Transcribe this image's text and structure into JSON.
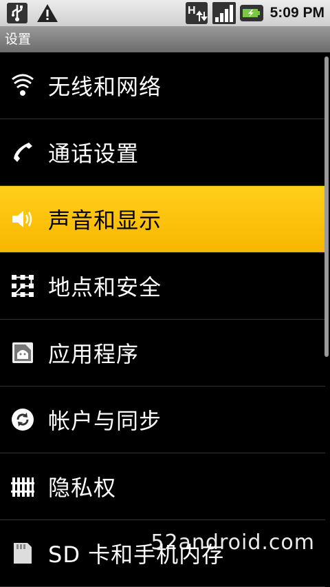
{
  "status_bar": {
    "time": "5:09 PM",
    "network_type": "H",
    "icons": [
      "usb-icon",
      "warning-icon",
      "network-h-icon",
      "signal-icon",
      "battery-charging-icon"
    ]
  },
  "title_bar": {
    "title": "设置"
  },
  "menu": {
    "items": [
      {
        "label": "无线和网络",
        "icon": "wifi-icon"
      },
      {
        "label": "通话设置",
        "icon": "phone-icon"
      },
      {
        "label": "声音和显示",
        "icon": "speaker-icon",
        "selected": true
      },
      {
        "label": "地点和安全",
        "icon": "pattern-lock-icon"
      },
      {
        "label": "应用程序",
        "icon": "applications-icon"
      },
      {
        "label": "帐户与同步",
        "icon": "sync-icon"
      },
      {
        "label": "隐私权",
        "icon": "privacy-icon"
      },
      {
        "label": "SD 卡和手机内存",
        "icon": "sd-card-icon"
      }
    ]
  },
  "colors": {
    "selection": "#ffc107",
    "background": "#000000",
    "divider": "#333333"
  },
  "watermark": {
    "text": "52android.com"
  }
}
